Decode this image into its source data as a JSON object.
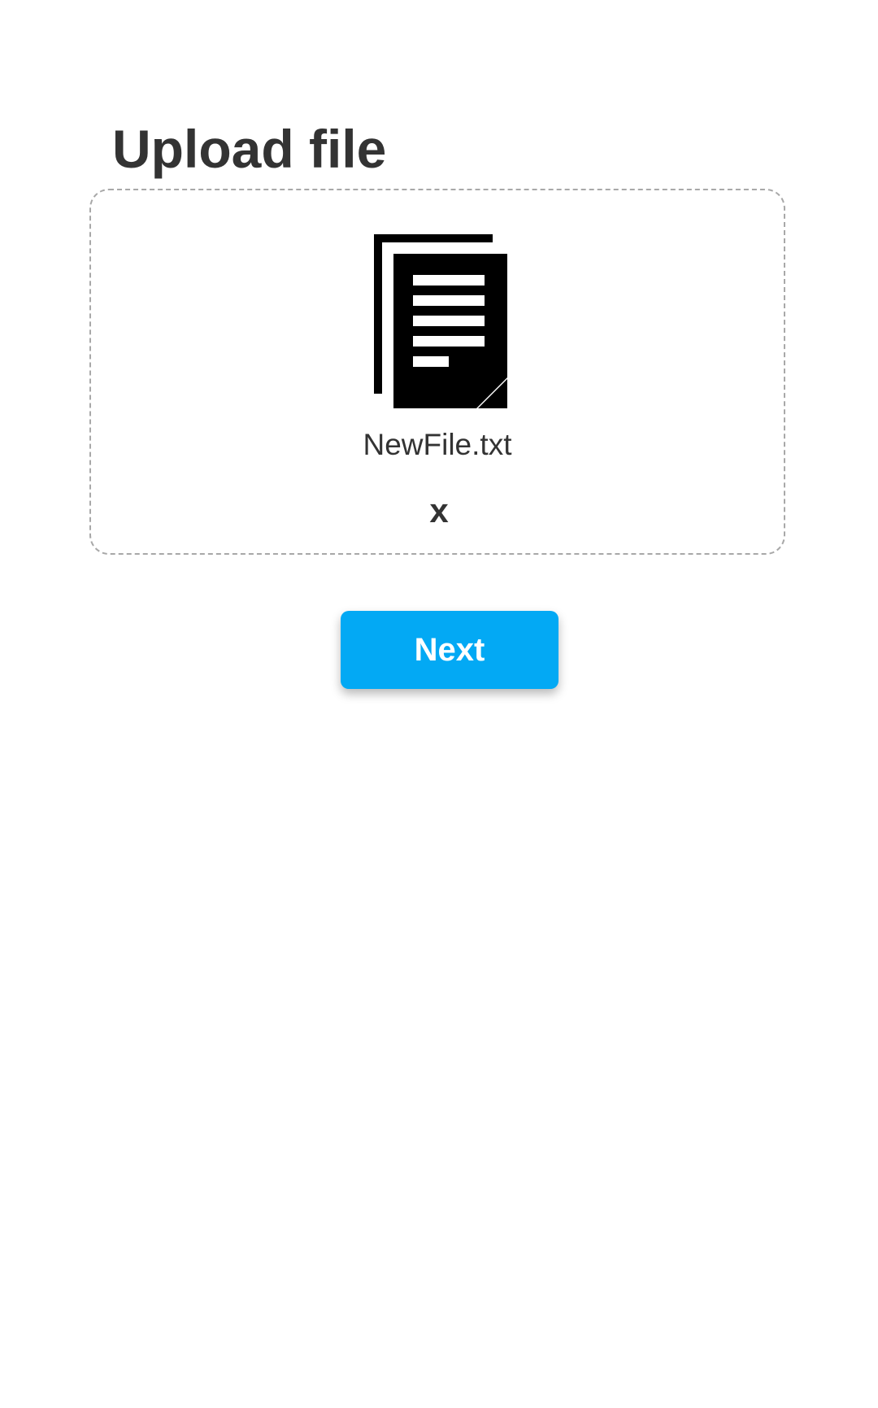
{
  "header": {
    "title": "Upload file"
  },
  "upload": {
    "file_icon": "document-stack-icon",
    "file_name": "NewFile.txt",
    "remove_label": "x"
  },
  "actions": {
    "next_label": "Next"
  },
  "colors": {
    "primary": "#03a9f4",
    "text": "#333333",
    "dropzone_border": "#a8a8a8"
  }
}
